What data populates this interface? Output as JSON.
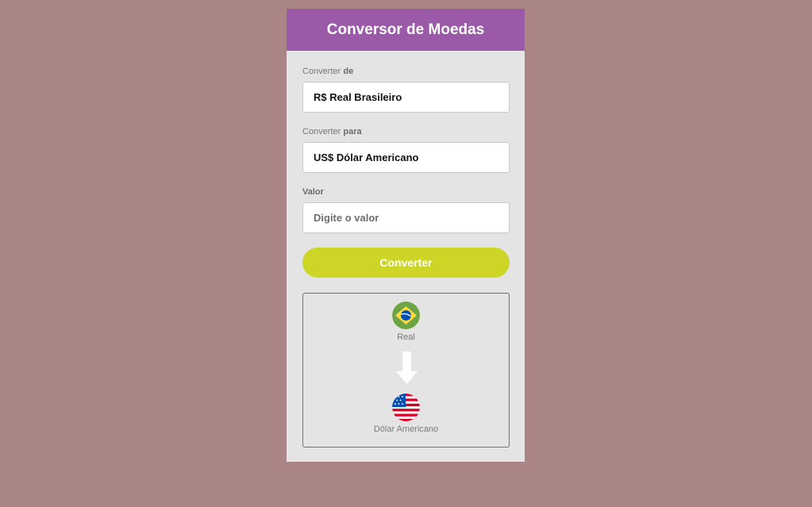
{
  "header": {
    "title": "Conversor de Moedas"
  },
  "form": {
    "from": {
      "label_prefix": "Converter",
      "label_bold": "de",
      "selected": "R$ Real Brasileiro"
    },
    "to": {
      "label_prefix": "Converter",
      "label_bold": "para",
      "selected": "US$ Dólar Americano"
    },
    "amount": {
      "label": "Valor",
      "placeholder": "Digite o valor",
      "value": ""
    },
    "convert_label": "Converter"
  },
  "result": {
    "from_name": "Real",
    "from_icon": "brazil-flag-icon",
    "arrow_icon": "arrow-down-icon",
    "to_name": "Dólar Americano",
    "to_icon": "usa-flag-icon"
  },
  "colors": {
    "page_background": "#a98585",
    "header_background": "#9b5aa8",
    "card_background": "#e4e4e4",
    "button_background": "#cdd627",
    "result_border": "#8e5a9a"
  }
}
